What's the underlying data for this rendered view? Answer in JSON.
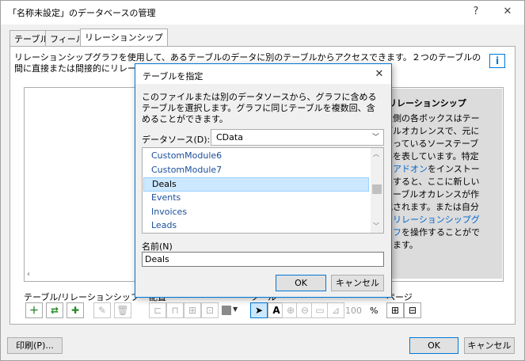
{
  "window": {
    "title": "「名称未設定」のデータベースの管理",
    "help_glyph": "?",
    "close_glyph": "✕"
  },
  "tabs": [
    {
      "label": "テーブル"
    },
    {
      "label": "フィールド"
    },
    {
      "label": "リレーションシップ"
    }
  ],
  "relationship": {
    "description": "リレーションシップグラフを使用して、あるテーブルのデータに別のテーブルからアクセスできます。２つのテーブルの間に直接または間接的にリレーションシップが定義されていると、一方のテ",
    "help_label": "i",
    "side_title": "リレーションシップ",
    "side_text_1": "左側の各ボックスはテーブルオカレンスで、元になっているソーステーブルを表しています。特定の",
    "side_link_1": "アドオン",
    "side_text_2": "をインストールすると、ここに新しいテーブルオカレンスが作成されます。または自分で",
    "side_link_2": "リレーションシップグラフ",
    "side_text_3": "を操作することができます。"
  },
  "toolbar": {
    "label_tables": "テーブル/リレーションシップ",
    "label_layout": "配置",
    "label_tools": "ツール",
    "label_page": "ページ",
    "zoom": "100",
    "zoom_unit": "%"
  },
  "footer": {
    "print_label": "印刷(P)...",
    "ok_label": "OK",
    "cancel_label": "キャンセル"
  },
  "dialog": {
    "title": "テーブルを指定",
    "description": "このファイルまたは別のデータソースから、グラフに含めるテーブルを選択します。グラフに同じテーブルを複数回、含めることができます。",
    "datasource_label": "データソース(D):",
    "datasource_value": "CData",
    "tables": [
      "CustomModule6",
      "CustomModule7",
      "Deals",
      "Events",
      "Invoices",
      "Leads"
    ],
    "selected_table": "Deals",
    "name_label": "名前(N)",
    "name_value": "Deals",
    "ok_label": "OK",
    "cancel_label": "キャンセル"
  },
  "colors": {
    "accent": "#0078d7",
    "selection": "#cce8ff",
    "link": "#0066cc"
  }
}
